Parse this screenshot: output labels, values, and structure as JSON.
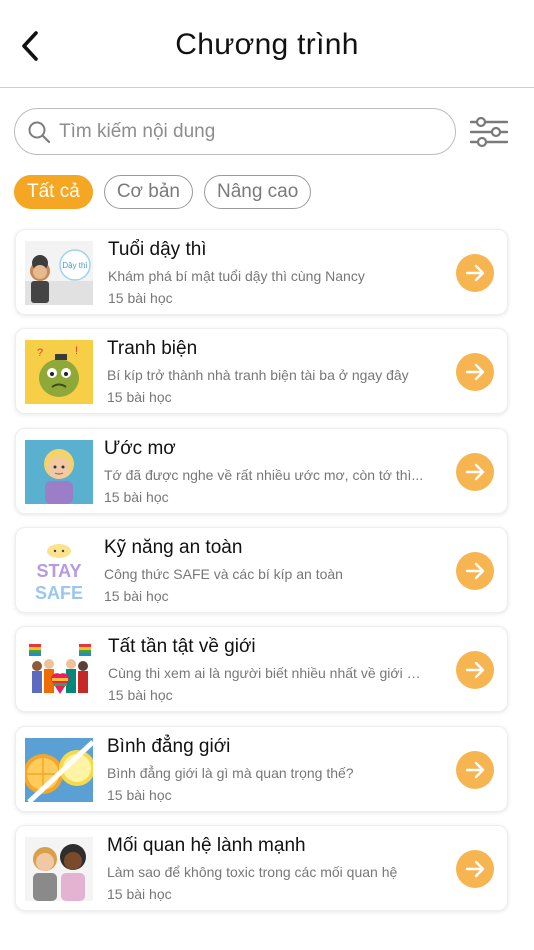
{
  "header": {
    "title": "Chương trình"
  },
  "search": {
    "placeholder": "Tìm kiếm nội dung"
  },
  "filters": [
    {
      "label": "Tất cả",
      "active": true
    },
    {
      "label": "Cơ bản",
      "active": false
    },
    {
      "label": "Nâng cao",
      "active": false
    }
  ],
  "lessons": [
    {
      "title": "Tuổi dậy thì",
      "desc": "Khám phá bí mật tuổi dậy thì cùng Nancy",
      "count": "15 bài học",
      "thumb_text": "Dậy thì"
    },
    {
      "title": "Tranh biện",
      "desc": "Bí kíp trở thành nhà tranh biện tài ba ở ngay đây",
      "count": "15 bài học"
    },
    {
      "title": "Ước mơ",
      "desc": "Tớ đã được nghe về rất nhiều ước mơ, còn tớ thì...",
      "count": "15 bài học"
    },
    {
      "title": "Kỹ năng an toàn",
      "desc": "Công thức SAFE và các bí kíp an toàn",
      "count": "15 bài học",
      "thumb_text_1": "STAY",
      "thumb_text_2": "SAFE"
    },
    {
      "title": "Tất tần tật về giới",
      "desc": "Cùng thi xem ai là người biết nhiều nhất về giới nào",
      "count": "15 bài học"
    },
    {
      "title": "Bình đẳng giới",
      "desc": "Bình đẳng giới là gì mà quan trọng thế?",
      "count": "15 bài học"
    },
    {
      "title": "Mối quan hệ lành mạnh",
      "desc": "Làm sao để không toxic trong các mối quan hệ",
      "count": "15 bài học"
    }
  ],
  "colors": {
    "accent": "#f5a623",
    "arrow_bg": "#f6b551"
  }
}
